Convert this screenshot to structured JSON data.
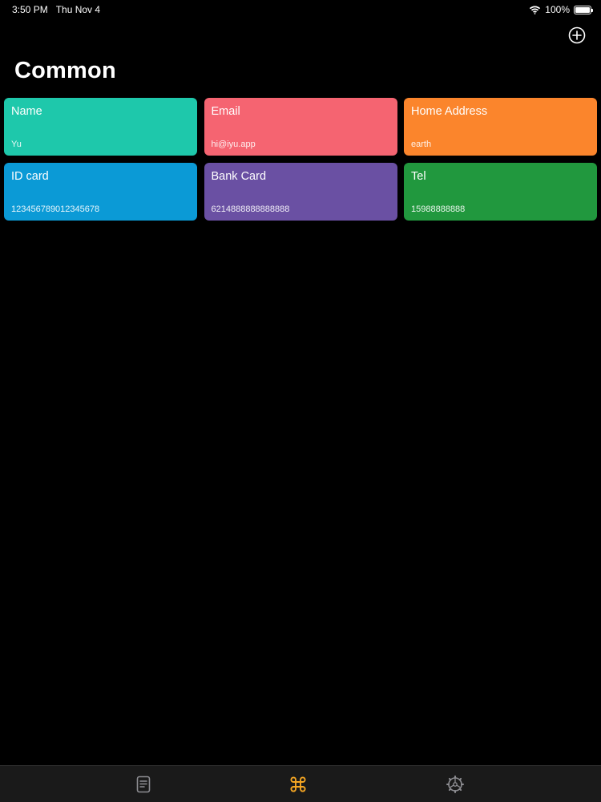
{
  "status_bar": {
    "time": "3:50 PM",
    "date": "Thu Nov 4",
    "battery_text": "100%",
    "battery_level": 1.0
  },
  "header": {
    "title": "Common",
    "add_icon": "plus-circle-icon"
  },
  "cards": [
    {
      "title": "Name",
      "value": "Yu",
      "color": "#1ec8ab"
    },
    {
      "title": "Email",
      "value": "hi@iyu.app",
      "color": "#f56471"
    },
    {
      "title": "Home Address",
      "value": "earth",
      "color": "#fb852c"
    },
    {
      "title": "ID card",
      "value": "123456789012345678",
      "color": "#0b9ad6"
    },
    {
      "title": "Bank Card",
      "value": "6214888888888888",
      "color": "#6a50a3"
    },
    {
      "title": "Tel",
      "value": "15988888888",
      "color": "#21983e"
    }
  ],
  "tab_bar": {
    "tabs": [
      {
        "icon": "document-icon",
        "active": false
      },
      {
        "icon": "command-icon",
        "active": true
      },
      {
        "icon": "settings-gear-icon",
        "active": false
      }
    ],
    "active_color": "#f5a623",
    "inactive_color": "#8e8e93"
  }
}
